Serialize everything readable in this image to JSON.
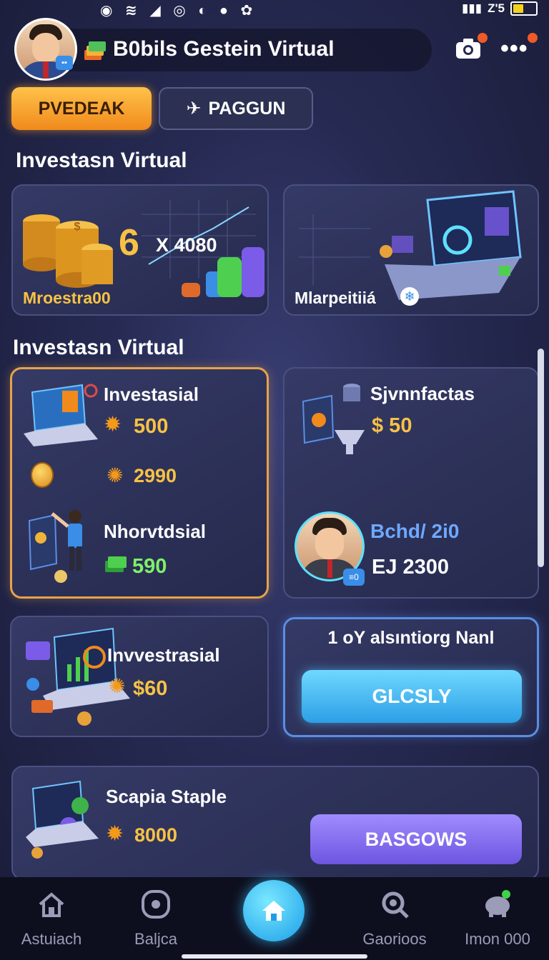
{
  "status_bar": {
    "time_right": "Z'5"
  },
  "header": {
    "title": "B0bils Gestein Virtual"
  },
  "tabs": [
    {
      "label": "PVEDEAK",
      "active": true
    },
    {
      "label": "PAGGUN",
      "active": false
    }
  ],
  "section1": {
    "title": "Investasn Virtual",
    "card_left": {
      "big_number": "6",
      "multiplier": "X 4080",
      "label": "Mroestra00"
    },
    "card_right": {
      "label": "Mlarpeitiiá"
    }
  },
  "section2": {
    "title": "Investasn Virtual",
    "card_a": {
      "title": "Investasial",
      "value1": "500",
      "value2": "2990",
      "subtitle": "Nhorvtdsial",
      "value3": "590"
    },
    "card_b": {
      "title": "Sjvnnfactas",
      "value1": "$ 50",
      "name": "Bchd/ 2i0",
      "value2": "EJ 2300"
    },
    "card_c": {
      "title": "Invvestrasial",
      "value": "$60"
    },
    "card_d": {
      "title": "1 oY alsıntiorg Nanl",
      "button": "GLCSLY"
    },
    "card_e": {
      "title": "Scapia Staple",
      "value": "8000",
      "button": "BASGOWS"
    }
  },
  "bottom_nav": [
    {
      "label": "Astuiach",
      "icon": "house-outline-icon"
    },
    {
      "label": "Baljca",
      "icon": "circle-target-icon"
    },
    {
      "label": "",
      "icon": "home-icon"
    },
    {
      "label": "Gaorioos",
      "icon": "search-icon"
    },
    {
      "label": "Imon 000",
      "icon": "piggy-bank-icon"
    }
  ],
  "colors": {
    "accent_orange": "#f08a1c",
    "accent_cyan": "#2c9fe6",
    "accent_purple": "#6d55e0",
    "gold": "#f7c244",
    "green": "#7ef06a"
  }
}
